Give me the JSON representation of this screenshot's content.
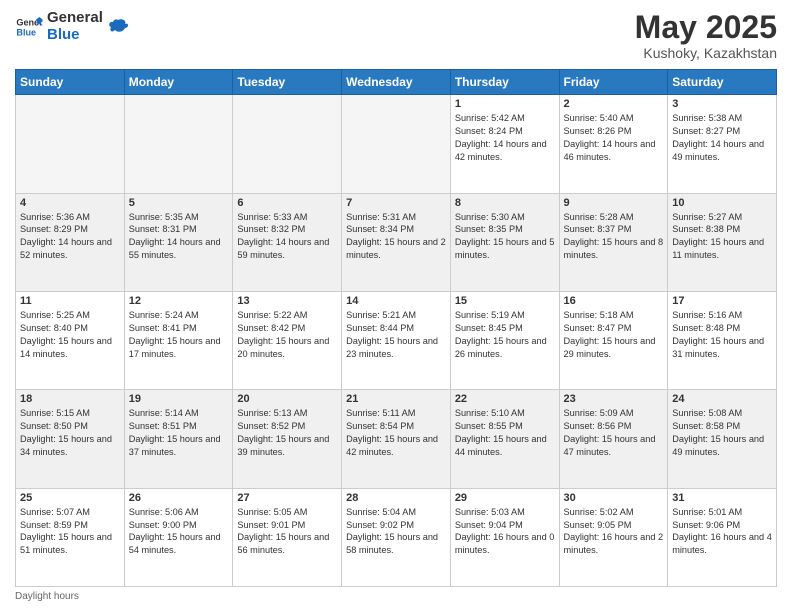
{
  "header": {
    "logo_general": "General",
    "logo_blue": "Blue",
    "month": "May 2025",
    "location": "Kushoky, Kazakhstan"
  },
  "weekdays": [
    "Sunday",
    "Monday",
    "Tuesday",
    "Wednesday",
    "Thursday",
    "Friday",
    "Saturday"
  ],
  "weeks": [
    [
      {
        "day": "",
        "empty": true
      },
      {
        "day": "",
        "empty": true
      },
      {
        "day": "",
        "empty": true
      },
      {
        "day": "",
        "empty": true
      },
      {
        "day": "1",
        "sunrise": "Sunrise: 5:42 AM",
        "sunset": "Sunset: 8:24 PM",
        "daylight": "Daylight: 14 hours and 42 minutes."
      },
      {
        "day": "2",
        "sunrise": "Sunrise: 5:40 AM",
        "sunset": "Sunset: 8:26 PM",
        "daylight": "Daylight: 14 hours and 46 minutes."
      },
      {
        "day": "3",
        "sunrise": "Sunrise: 5:38 AM",
        "sunset": "Sunset: 8:27 PM",
        "daylight": "Daylight: 14 hours and 49 minutes."
      }
    ],
    [
      {
        "day": "4",
        "sunrise": "Sunrise: 5:36 AM",
        "sunset": "Sunset: 8:29 PM",
        "daylight": "Daylight: 14 hours and 52 minutes."
      },
      {
        "day": "5",
        "sunrise": "Sunrise: 5:35 AM",
        "sunset": "Sunset: 8:31 PM",
        "daylight": "Daylight: 14 hours and 55 minutes."
      },
      {
        "day": "6",
        "sunrise": "Sunrise: 5:33 AM",
        "sunset": "Sunset: 8:32 PM",
        "daylight": "Daylight: 14 hours and 59 minutes."
      },
      {
        "day": "7",
        "sunrise": "Sunrise: 5:31 AM",
        "sunset": "Sunset: 8:34 PM",
        "daylight": "Daylight: 15 hours and 2 minutes."
      },
      {
        "day": "8",
        "sunrise": "Sunrise: 5:30 AM",
        "sunset": "Sunset: 8:35 PM",
        "daylight": "Daylight: 15 hours and 5 minutes."
      },
      {
        "day": "9",
        "sunrise": "Sunrise: 5:28 AM",
        "sunset": "Sunset: 8:37 PM",
        "daylight": "Daylight: 15 hours and 8 minutes."
      },
      {
        "day": "10",
        "sunrise": "Sunrise: 5:27 AM",
        "sunset": "Sunset: 8:38 PM",
        "daylight": "Daylight: 15 hours and 11 minutes."
      }
    ],
    [
      {
        "day": "11",
        "sunrise": "Sunrise: 5:25 AM",
        "sunset": "Sunset: 8:40 PM",
        "daylight": "Daylight: 15 hours and 14 minutes."
      },
      {
        "day": "12",
        "sunrise": "Sunrise: 5:24 AM",
        "sunset": "Sunset: 8:41 PM",
        "daylight": "Daylight: 15 hours and 17 minutes."
      },
      {
        "day": "13",
        "sunrise": "Sunrise: 5:22 AM",
        "sunset": "Sunset: 8:42 PM",
        "daylight": "Daylight: 15 hours and 20 minutes."
      },
      {
        "day": "14",
        "sunrise": "Sunrise: 5:21 AM",
        "sunset": "Sunset: 8:44 PM",
        "daylight": "Daylight: 15 hours and 23 minutes."
      },
      {
        "day": "15",
        "sunrise": "Sunrise: 5:19 AM",
        "sunset": "Sunset: 8:45 PM",
        "daylight": "Daylight: 15 hours and 26 minutes."
      },
      {
        "day": "16",
        "sunrise": "Sunrise: 5:18 AM",
        "sunset": "Sunset: 8:47 PM",
        "daylight": "Daylight: 15 hours and 29 minutes."
      },
      {
        "day": "17",
        "sunrise": "Sunrise: 5:16 AM",
        "sunset": "Sunset: 8:48 PM",
        "daylight": "Daylight: 15 hours and 31 minutes."
      }
    ],
    [
      {
        "day": "18",
        "sunrise": "Sunrise: 5:15 AM",
        "sunset": "Sunset: 8:50 PM",
        "daylight": "Daylight: 15 hours and 34 minutes."
      },
      {
        "day": "19",
        "sunrise": "Sunrise: 5:14 AM",
        "sunset": "Sunset: 8:51 PM",
        "daylight": "Daylight: 15 hours and 37 minutes."
      },
      {
        "day": "20",
        "sunrise": "Sunrise: 5:13 AM",
        "sunset": "Sunset: 8:52 PM",
        "daylight": "Daylight: 15 hours and 39 minutes."
      },
      {
        "day": "21",
        "sunrise": "Sunrise: 5:11 AM",
        "sunset": "Sunset: 8:54 PM",
        "daylight": "Daylight: 15 hours and 42 minutes."
      },
      {
        "day": "22",
        "sunrise": "Sunrise: 5:10 AM",
        "sunset": "Sunset: 8:55 PM",
        "daylight": "Daylight: 15 hours and 44 minutes."
      },
      {
        "day": "23",
        "sunrise": "Sunrise: 5:09 AM",
        "sunset": "Sunset: 8:56 PM",
        "daylight": "Daylight: 15 hours and 47 minutes."
      },
      {
        "day": "24",
        "sunrise": "Sunrise: 5:08 AM",
        "sunset": "Sunset: 8:58 PM",
        "daylight": "Daylight: 15 hours and 49 minutes."
      }
    ],
    [
      {
        "day": "25",
        "sunrise": "Sunrise: 5:07 AM",
        "sunset": "Sunset: 8:59 PM",
        "daylight": "Daylight: 15 hours and 51 minutes."
      },
      {
        "day": "26",
        "sunrise": "Sunrise: 5:06 AM",
        "sunset": "Sunset: 9:00 PM",
        "daylight": "Daylight: 15 hours and 54 minutes."
      },
      {
        "day": "27",
        "sunrise": "Sunrise: 5:05 AM",
        "sunset": "Sunset: 9:01 PM",
        "daylight": "Daylight: 15 hours and 56 minutes."
      },
      {
        "day": "28",
        "sunrise": "Sunrise: 5:04 AM",
        "sunset": "Sunset: 9:02 PM",
        "daylight": "Daylight: 15 hours and 58 minutes."
      },
      {
        "day": "29",
        "sunrise": "Sunrise: 5:03 AM",
        "sunset": "Sunset: 9:04 PM",
        "daylight": "Daylight: 16 hours and 0 minutes."
      },
      {
        "day": "30",
        "sunrise": "Sunrise: 5:02 AM",
        "sunset": "Sunset: 9:05 PM",
        "daylight": "Daylight: 16 hours and 2 minutes."
      },
      {
        "day": "31",
        "sunrise": "Sunrise: 5:01 AM",
        "sunset": "Sunset: 9:06 PM",
        "daylight": "Daylight: 16 hours and 4 minutes."
      }
    ]
  ],
  "footer": "Daylight hours"
}
